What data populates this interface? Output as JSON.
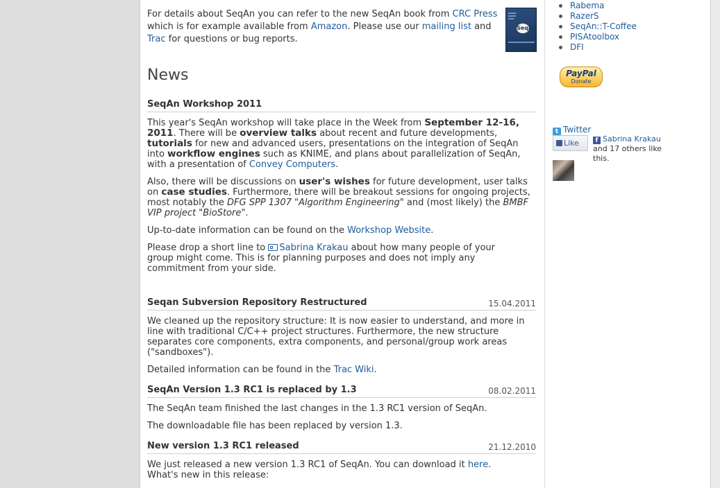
{
  "intro": {
    "t1": "For details about SeqAn you can refer to the new SeqAn book from ",
    "l1": "CRC Press",
    "t2": " which is for example available from ",
    "l2": "Amazon",
    "t3": ". Please use our ",
    "l3": "mailing list",
    "t4": " and ",
    "l4": "Trac",
    "t5": " for questions or bug reports.",
    "book_logo": "SeqAn"
  },
  "news_heading": "News",
  "news": [
    {
      "title": "SeqAn Workshop 2011",
      "date": "",
      "p1": {
        "a": "This year's SeqAn workshop will take place in the Week from ",
        "b": "September 12-16, 2011",
        "c": ". There will be ",
        "d": "overview talks",
        "e": " about recent and future developments, ",
        "f": "tutorials",
        "g": " for new and advanced users, presentations on the integration of SeqAn into ",
        "h": "workflow engines",
        "i": " such as KNIME, and plans about parallelization of SeqAn, with a presentation of ",
        "j": "Convey Computers",
        "k": "."
      },
      "p2": {
        "a": "Also, there will be discussions on ",
        "b": "user's wishes",
        "c": " for future development, user talks on ",
        "d": "case studies",
        "e": ". Furthermore, there will be breakout sessions for ongoing projects, most notably the ",
        "f": "DFG SPP 1307 \"Algorithm Engineering\"",
        "g": " and (most likely) the ",
        "h": "BMBF VIP project \"BioStore\"",
        "i": "."
      },
      "p3": {
        "a": "Up-to-date information can be found on the ",
        "b": "Workshop Website",
        "c": "."
      },
      "p4": {
        "a": "Please drop a short line to ",
        "b": "Sabrina Krakau",
        "c": " about how many people of your group might come. This is for planning purposes and does not imply any commitment from your side."
      }
    },
    {
      "title": "Seqan Subversion Repository Restructured",
      "date": "15.04.2011",
      "p1": "We cleaned up the repository structure: It is now easier to understand, and more in line with traditional C/C++ project structures. Furthermore, the new structure separates core components, extra components, and personal/group work areas (\"sandboxes\").",
      "p2a": "Detailed information can be found in the ",
      "p2b": "Trac Wiki",
      "p2c": "."
    },
    {
      "title": "SeqAn Version 1.3 RC1 is replaced by 1.3",
      "date": "08.02.2011",
      "p1": "The SeqAn team finished the last changes in the 1.3 RC1 version of SeqAn.",
      "p2": "The downloadable file has been replaced by version 1.3."
    },
    {
      "title": "New version 1.3 RC1 released",
      "date": "21.12.2010",
      "p1a": "We just released a new version 1.3 RC1 of SeqAn. You can download it ",
      "p1b": "here",
      "p1c": ".",
      "p1d": "What's new in this release:"
    }
  ],
  "sidebar": {
    "projects": [
      "Rabema",
      "RazerS",
      "SeqAn::T-Coffee",
      "PISAtoolbox",
      "DFI"
    ],
    "paypal": {
      "brand": "PayPal",
      "label": "Donate"
    },
    "twitter_label": "Twitter",
    "like_label": "Like",
    "fb_name": "Sabrina Krakau",
    "fb_rest": " and 17 others like this."
  }
}
